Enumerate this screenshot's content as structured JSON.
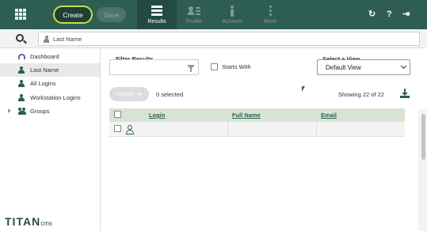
{
  "header": {
    "create_label": "Create",
    "save_label": "Save",
    "tabs": [
      {
        "label": "Results",
        "icon": "list-icon",
        "active": true
      },
      {
        "label": "Profile",
        "icon": "profile-icon",
        "active": false
      },
      {
        "label": "Account",
        "icon": "info-icon",
        "active": false
      },
      {
        "label": "More",
        "icon": "more-icon",
        "active": false
      }
    ],
    "right_icons": [
      "refresh-icon",
      "help-icon",
      "logout-icon"
    ]
  },
  "search": {
    "value": "Last Name"
  },
  "sidebar": {
    "items": [
      {
        "label": "Dashboard",
        "icon": "dashboard-icon",
        "active": false
      },
      {
        "label": "Last Name",
        "icon": "user-icon",
        "active": true
      },
      {
        "label": "All Logins",
        "icon": "user-icon",
        "active": false
      },
      {
        "label": "Workstation Logins",
        "icon": "user-icon",
        "active": false
      },
      {
        "label": "Groups",
        "icon": "groups-icon",
        "active": false,
        "expandable": true
      }
    ],
    "logo_main": "TITAN",
    "logo_sub": "cms"
  },
  "filters": {
    "filter_label": "Filter Results",
    "filter_value": "",
    "starts_with_label": "Starts With",
    "starts_with_checked": false,
    "view_label": "Select a View",
    "view_value": "Default View"
  },
  "toolbar": {
    "actions_label": "Actions",
    "selected_text": "0 selected",
    "showing_text": "Showing 22 of 22"
  },
  "table": {
    "columns": [
      "Login",
      "Full Name",
      "Email"
    ],
    "rows": [
      {
        "login": "",
        "full_name": "",
        "email": ""
      }
    ]
  },
  "colors": {
    "header_bg": "#2e5d52",
    "create_border": "#c6e04a",
    "table_header_bg": "#d7e4d4"
  }
}
